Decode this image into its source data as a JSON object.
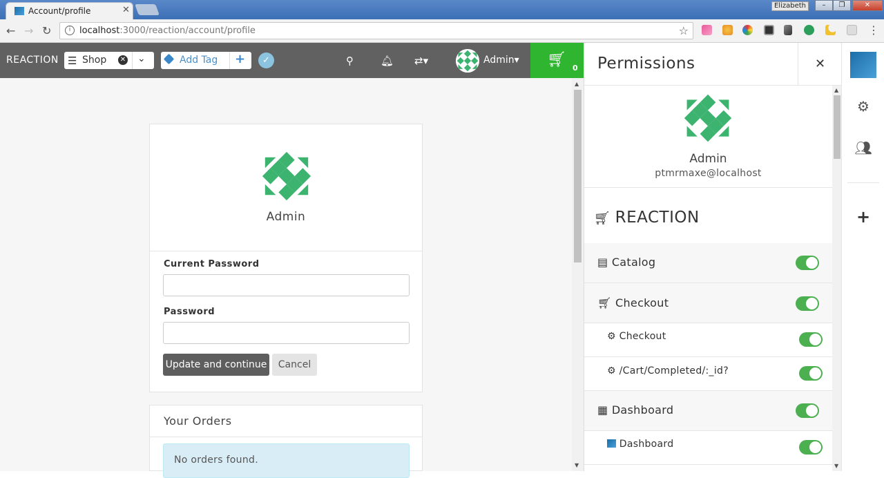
{
  "browser": {
    "tab_title": "Account/profile",
    "url_host": "localhost",
    "url_rest": ":3000/reaction/account/profile",
    "user_badge": "Elizabeth"
  },
  "header": {
    "brand": "REACTION",
    "shop_label": "Shop",
    "add_tag_label": "Add Tag",
    "admin_name": "Admin",
    "cart_count": "0",
    "colors": {
      "bar": "#616161",
      "cart": "#2fb52f"
    }
  },
  "profile": {
    "name": "Admin",
    "current_password_label": "Current Password",
    "password_label": "Password",
    "update_button": "Update and continue",
    "cancel_button": "Cancel"
  },
  "orders": {
    "title": "Your Orders",
    "empty_text": "No orders found."
  },
  "permissions": {
    "title": "Permissions",
    "user_name": "Admin",
    "user_email": "ptmrmaxe@localhost",
    "section": "REACTION",
    "rows": [
      {
        "label": "Catalog",
        "type": "group",
        "icon": "archive-icon",
        "enabled": true
      },
      {
        "label": "Checkout",
        "type": "group",
        "icon": "cart-icon",
        "enabled": true
      },
      {
        "label": "Checkout",
        "type": "sub",
        "icon": "gear-icon",
        "enabled": true
      },
      {
        "label": "/Cart/Completed/:_id?",
        "type": "sub",
        "icon": "gear-icon",
        "enabled": true
      },
      {
        "label": "Dashboard",
        "type": "group",
        "icon": "grid-icon",
        "enabled": true
      },
      {
        "label": "Dashboard",
        "type": "sub",
        "icon": "reaction-logo-icon",
        "enabled": true
      }
    ],
    "toggle_color": "#4caf50"
  }
}
